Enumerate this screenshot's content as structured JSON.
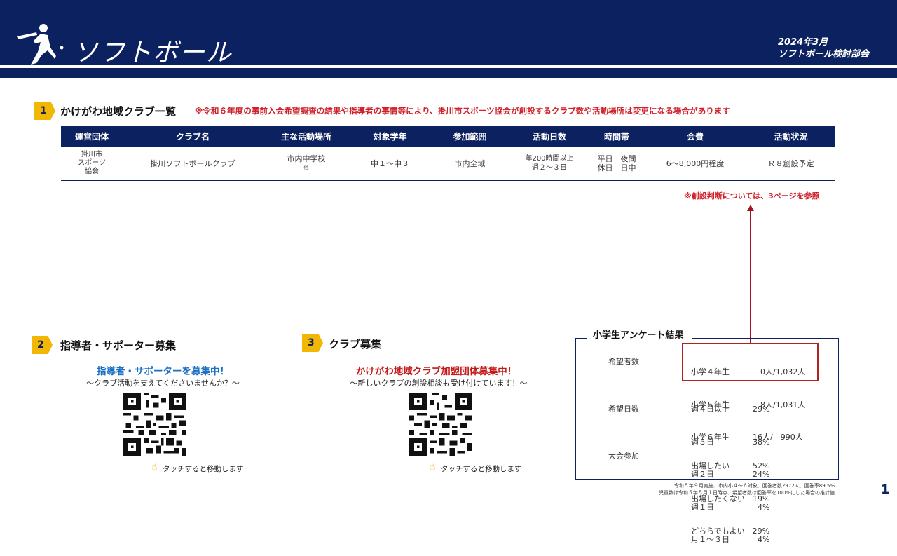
{
  "header": {
    "title": "ソフトボール",
    "date": "2024年3月",
    "committee": "ソフトボール検討部会",
    "colors": {
      "navy": "#0b2160",
      "accent": "#f2b705",
      "red": "#d0202a"
    }
  },
  "section1": {
    "number": "1",
    "title": "かけがわ地域クラブ一覧",
    "notice": "※令和６年度の事前入会希望調査の結果や指導者の事情等により、掛川市スポーツ協会が創設するクラブ数や活動場所は変更になる場合があります",
    "columns": [
      "運営団体",
      "クラブ名",
      "主な活動場所",
      "対象学年",
      "参加範囲",
      "活動日数",
      "時間帯",
      "会費",
      "活動状況"
    ],
    "row": {
      "org": [
        "掛川市",
        "スポーツ",
        "協会"
      ],
      "club": "掛川ソフトボールクラブ",
      "place": "市内中学校",
      "place_note": "他",
      "grade": "中１～中３",
      "range": "市内全域",
      "days": [
        "年200時間以上",
        "週２～３日"
      ],
      "time": [
        "平日　夜間",
        "休日　日中"
      ],
      "fee": "6～8,000円程度",
      "status": "Ｒ８創設予定"
    },
    "footnote": "※創設判断については、3ページを参照"
  },
  "section2": {
    "number": "2",
    "title": "指導者・サポーター募集",
    "headline": "指導者・サポーターを募集中！",
    "subline": "～クラブ活動を支えてくださいませんか？～",
    "touch": "タッチすると移動します"
  },
  "section3": {
    "number": "3",
    "title": "クラブ募集",
    "headline": "かけがわ地域クラブ加盟団体募集中！",
    "subline": "～新しいクラブの創設相談も受け付けています！～",
    "touch": "タッチすると移動します"
  },
  "survey": {
    "title": "小学生アンケート結果",
    "groups": [
      {
        "label": "希望者数",
        "rows": [
          "小学４年生　　　　0人/1,032人",
          "小学５年生　　　　8人/1,031人",
          "小学６年生　　　16人/　990人"
        ]
      },
      {
        "label": "希望日数",
        "rows": [
          "週４日以上　　　29%",
          "週３日　　　　　38%",
          "週２日　　　　　24%",
          "週１日　　　　　  4%",
          "月１～３日　　　  4%"
        ]
      },
      {
        "label": "大会参加",
        "rows": [
          "出場したい　　　52%",
          "出場したくない　19%",
          "どちらでもよい　29%"
        ]
      }
    ],
    "notes": [
      "令和５年９月実施、市内小４～６対象、回答者数2972人、回答率89.5%",
      "児童数は令和５年５月１日時点、希望者数は回答率を100%にした場合の推計値"
    ]
  },
  "page_number": "1"
}
